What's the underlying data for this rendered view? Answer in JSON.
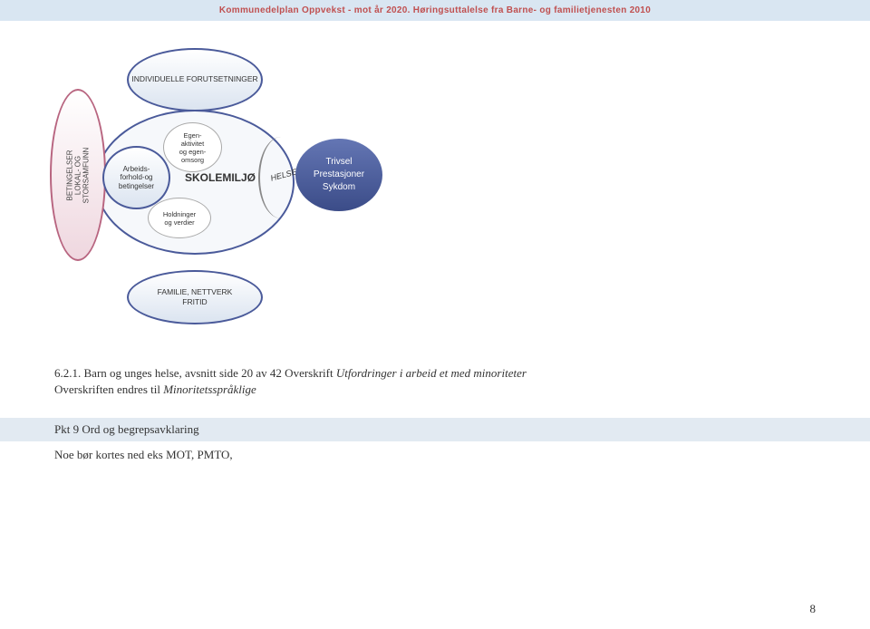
{
  "header": {
    "title": "Kommunedelplan Oppvekst - mot år 2020. Høringsuttalelse fra Barne- og familietjenesten 2010"
  },
  "diagram": {
    "big_left": "BETINGELSER\nLOKAL- OG\nSTORSAMFUNN",
    "top": "INDIVIDUELLE FORUTSETNINGER",
    "arbeid": "Arbeids-\nforhold-og\nbetingelser",
    "egen": "Egen-\naktivitet\nog egen-\nomsorg",
    "skole": "SKOLEMILJØ",
    "hold": "Holdninger\nog verdier",
    "helse": "HELSE",
    "trivsel": "Trivsel\nPrestasjoner\nSykdom",
    "fam": "FAMILIE, NETTVERK\nFRITID"
  },
  "body": {
    "line1": "6.2.1. Barn og unges helse, avsnitt side 20 av 42 Overskrift ",
    "line1_italic": "Utfordringer i arbeid et med minoriteter",
    "line2a": "Overskriften endres til ",
    "line2b": "Minoritetsspråklige",
    "section": "Pkt 9 Ord og begrepsavklaring",
    "line3": "Noe bør kortes ned eks MOT, PMTO,"
  },
  "page": {
    "number": "8"
  }
}
